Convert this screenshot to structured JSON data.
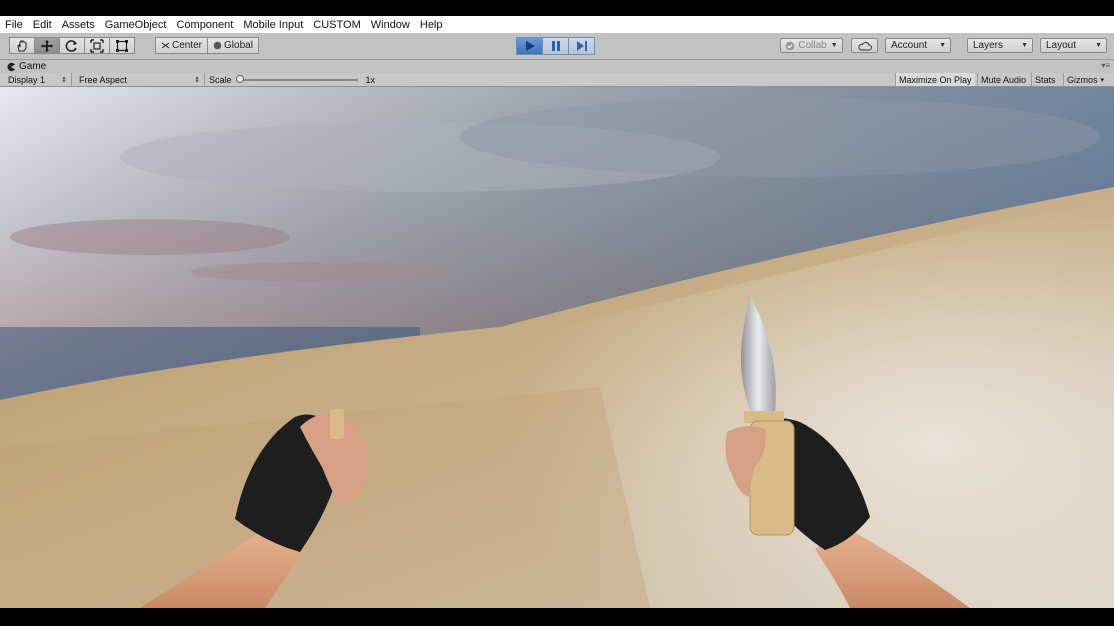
{
  "menu": {
    "items": [
      {
        "label": "File"
      },
      {
        "label": "Edit"
      },
      {
        "label": "Assets"
      },
      {
        "label": "GameObject"
      },
      {
        "label": "Component"
      },
      {
        "label": "Mobile Input"
      },
      {
        "label": "CUSTOM"
      },
      {
        "label": "Window"
      },
      {
        "label": "Help"
      }
    ]
  },
  "toolbar": {
    "tools": [
      "hand-tool-icon",
      "move-tool-icon",
      "rotate-tool-icon",
      "scale-tool-icon",
      "rect-tool-icon"
    ],
    "pivot_label": "Center",
    "space_label": "Global",
    "collab_label": "Collab",
    "account_label": "Account",
    "layers_label": "Layers",
    "layout_label": "Layout"
  },
  "game_view": {
    "tab_label": "Game",
    "display_label": "Display 1",
    "aspect_label": "Free Aspect",
    "scale_label": "Scale",
    "scale_value": "1x",
    "maximize_label": "Maximize On Play",
    "mute_label": "Mute Audio",
    "stats_label": "Stats",
    "gizmos_label": "Gizmos"
  },
  "colors": {
    "accent": "#3b73be",
    "toolbar_bg": "#c2c2c2"
  }
}
